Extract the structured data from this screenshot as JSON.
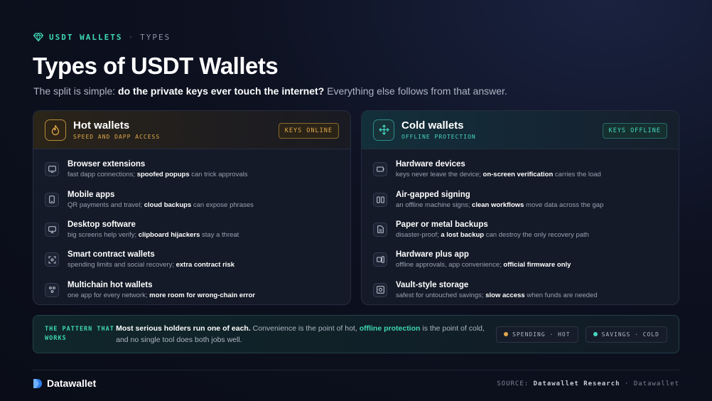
{
  "eyebrow": {
    "brand": "USDT WALLETS",
    "sep": "·",
    "sub": "TYPES"
  },
  "title": "Types of USDT Wallets",
  "subtitle": {
    "pre": "The split is simple: ",
    "bold": "do the private keys ever touch the internet?",
    "post": " Everything else follows from that answer."
  },
  "hot": {
    "title": "Hot wallets",
    "subtitle": "SPEED AND DAPP ACCESS",
    "badge": "KEYS ONLINE",
    "icon": "flame-icon",
    "accent": "#e1a84a",
    "items": [
      {
        "icon": "browser-icon",
        "title": "Browser extensions",
        "desc_pre": "fast dapp connections; ",
        "desc_bold": "spoofed popups",
        "desc_post": " can trick approvals"
      },
      {
        "icon": "phone-icon",
        "title": "Mobile apps",
        "desc_pre": "QR payments and travel; ",
        "desc_bold": "cloud backups",
        "desc_post": " can expose phrases"
      },
      {
        "icon": "monitor-icon",
        "title": "Desktop software",
        "desc_pre": "big screens help verify; ",
        "desc_bold": "clipboard hijackers",
        "desc_post": " stay a threat"
      },
      {
        "icon": "contract-icon",
        "title": "Smart contract wallets",
        "desc_pre": "spending limits and social recovery; ",
        "desc_bold": "extra contract risk",
        "desc_post": ""
      },
      {
        "icon": "network-icon",
        "title": "Multichain hot wallets",
        "desc_pre": "one app for every network; ",
        "desc_bold": "more room for wrong-chain error",
        "desc_post": ""
      }
    ]
  },
  "cold": {
    "title": "Cold wallets",
    "subtitle": "OFFLINE PROTECTION",
    "badge": "KEYS OFFLINE",
    "icon": "move-icon",
    "accent": "#48d6c1",
    "items": [
      {
        "icon": "device-icon",
        "title": "Hardware devices",
        "desc_pre": "keys never leave the device; ",
        "desc_bold": "on-screen verification",
        "desc_post": " carries the load"
      },
      {
        "icon": "airgap-icon",
        "title": "Air-gapped signing",
        "desc_pre": "an offline machine signs; ",
        "desc_bold": "clean workflows",
        "desc_post": " move data across the gap"
      },
      {
        "icon": "document-icon",
        "title": "Paper or metal backups",
        "desc_pre": "disaster-proof; ",
        "desc_bold": "a lost backup",
        "desc_post": " can destroy the only recovery path"
      },
      {
        "icon": "device-app-icon",
        "title": "Hardware plus app",
        "desc_pre": "offline approvals, app convenience; ",
        "desc_bold": "official firmware only",
        "desc_post": ""
      },
      {
        "icon": "vault-icon",
        "title": "Vault-style storage",
        "desc_pre": "safest for untouched savings; ",
        "desc_bold": "slow access",
        "desc_post": " when funds are needed"
      }
    ]
  },
  "pattern": {
    "label": "THE PATTERN THAT WORKS",
    "bold": "Most serious holders run one of each.",
    "mid": " Convenience is the point of hot, ",
    "accent": "offline protection",
    "post": " is the point of cold, and no single tool does both jobs well.",
    "chips": [
      {
        "label": "SPENDING · HOT",
        "color": "#e1a84a"
      },
      {
        "label": "SAVINGS · COLD",
        "color": "#48d6c1"
      }
    ]
  },
  "footer": {
    "logo": "Datawallet",
    "source_label": "SOURCE: ",
    "source_name": "Datawallet Research",
    "source_sep": " · ",
    "source_brand": "Datawallet"
  }
}
